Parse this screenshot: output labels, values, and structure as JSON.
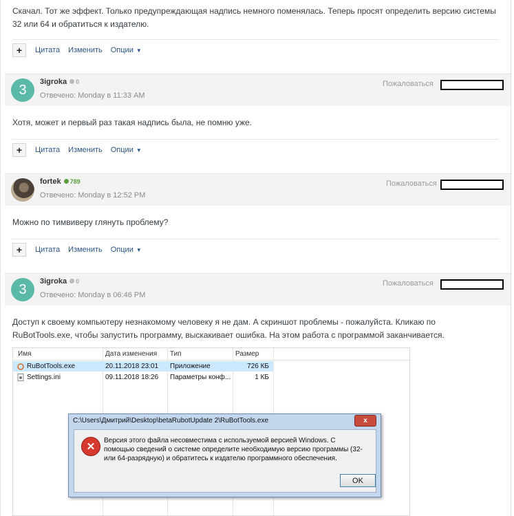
{
  "posts": [
    {
      "body": "Скачал. Тот же эффект. Только предупреждающая надпись немного поменялась. Теперь просят определить версию системы 32 или 64 и обратиться к издателю."
    },
    {
      "author": "3igroka",
      "avatar_letter": "3",
      "reputation": "0",
      "date": "Отвечено: Monday в 11:33 AM",
      "report": "Пожаловаться",
      "body": "Хотя, может и первый раз такая надпись была, не помню уже."
    },
    {
      "author": "fortek",
      "reputation": "789",
      "date": "Отвечено: Monday в 12:52 PM",
      "report": "Пожаловаться",
      "body": "Можно по тимвиверу глянуть проблему?"
    },
    {
      "author": "3igroka",
      "avatar_letter": "3",
      "reputation": "0",
      "date": "Отвечено: Monday в 06:46 PM",
      "report": "Пожаловаться",
      "body": "Доступ к своему компьютеру незнакомому человеку я не дам. А скриншот проблемы - пожалуйста. Кликаю по RuBotTools.exe, чтобы запустить программу, выскакивает ошибка. На этом работа с программой заканчивается."
    }
  ],
  "actions": {
    "plus": "+",
    "quote": "Цитата",
    "edit": "Изменить",
    "options": "Опции",
    "caret": "▼"
  },
  "screenshot": {
    "columns": [
      "Имя",
      "Дата изменения",
      "Тип",
      "Размер"
    ],
    "files": [
      {
        "name": "RuBotTools.exe",
        "date": "20.11.2018 23:01",
        "type": "Приложение",
        "size": "726 КБ"
      },
      {
        "name": "Settings.ini",
        "date": "09.11.2018 18:26",
        "type": "Параметры конф...",
        "size": "1 КБ"
      }
    ],
    "dialog": {
      "title": "C:\\Users\\Дмитрий\\Desktop\\betaRubotUpdate 2\\RuBotTools.exe",
      "close": "x",
      "message": "Версия этого файла несовместима с используемой версией Windows. С помощью сведений о системе определите необходимую версию программы (32- или 64-разрядную) и обратитесь к издателю программного обеспечения.",
      "ok": "OK"
    }
  },
  "colors": {
    "avatar_teal": "#5ab9a8",
    "link": "#2c5687",
    "rep_green": "#5a9d3c",
    "error_red": "#d63a2e"
  }
}
